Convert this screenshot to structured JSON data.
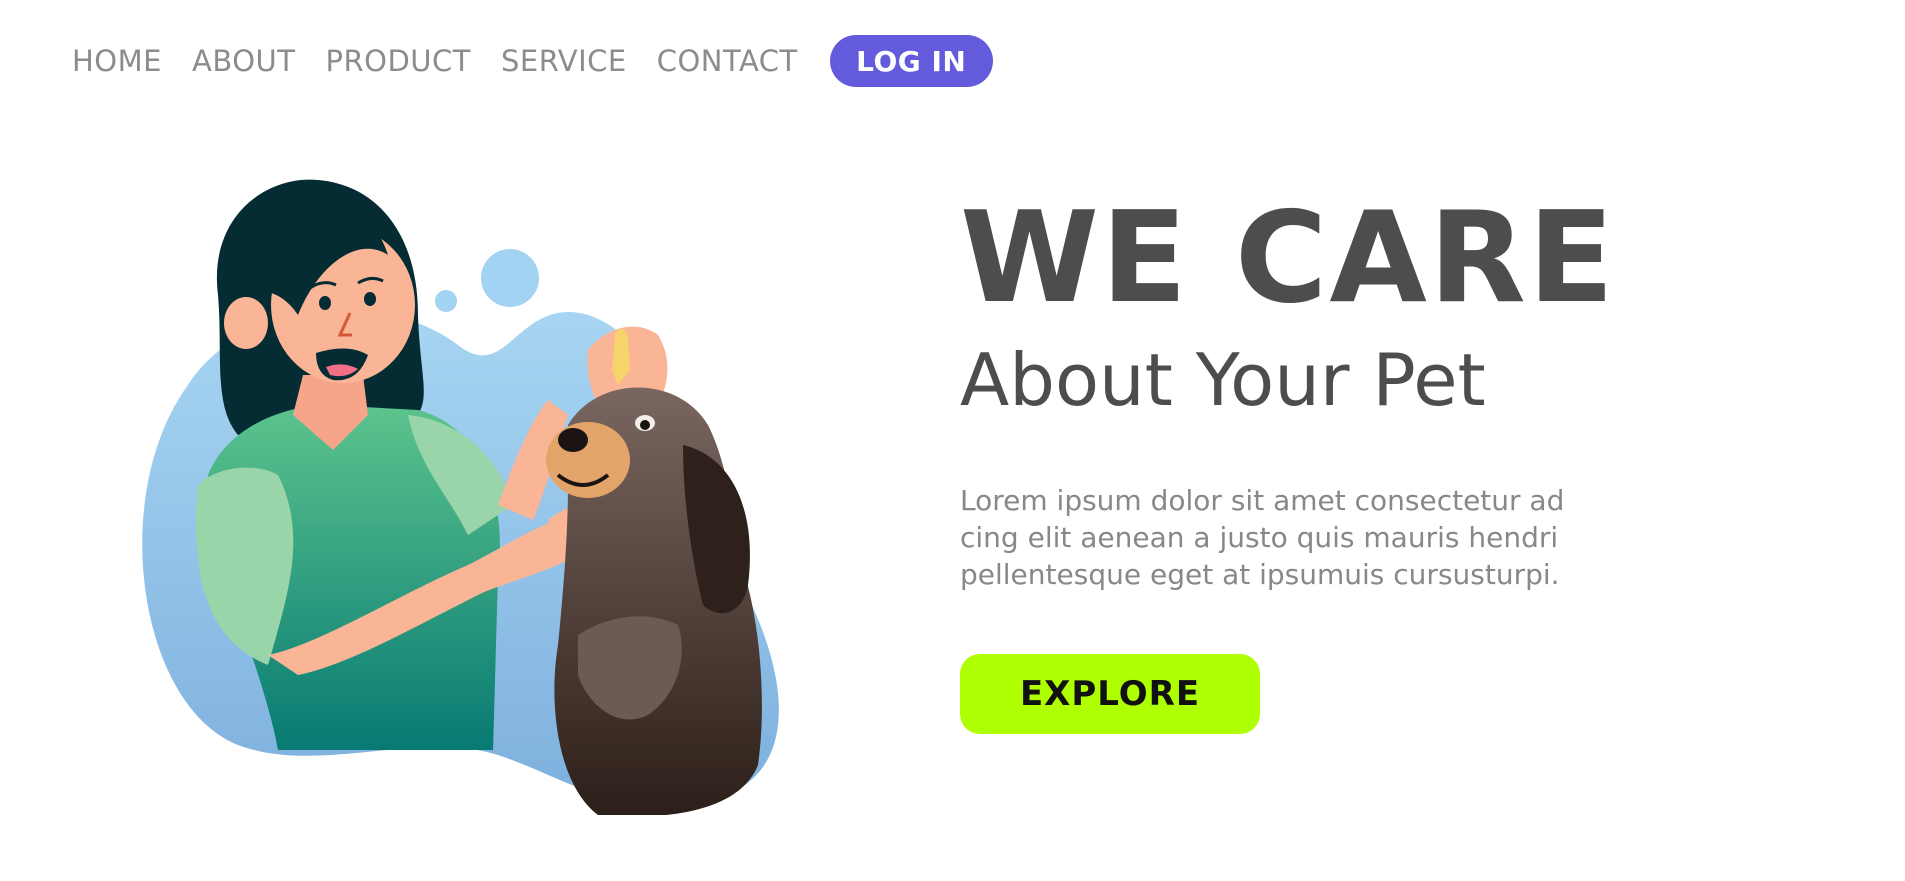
{
  "nav": {
    "links": [
      "HOME",
      "ABOUT",
      "PRODUCT",
      "SERVICE",
      "CONTACT"
    ],
    "login_label": "LOG IN"
  },
  "hero": {
    "headline": "WE CARE",
    "subheadline": "About Your Pet",
    "body_lines": [
      "Lorem ipsum dolor sit amet consectetur ad",
      "cing elit aenean a justo quis mauris hendri",
      "pellentesque eget at ipsumuis cursusturpi."
    ],
    "explore_label": "EXPLORE",
    "illustration": "woman-giving-dog-eye-drops"
  },
  "colors": {
    "login_bg": "#635bdb",
    "explore_bg": "#adff02",
    "headline": "#4d4d4d",
    "nav_text": "#8c8c8c",
    "blob": "#9fcdee"
  }
}
